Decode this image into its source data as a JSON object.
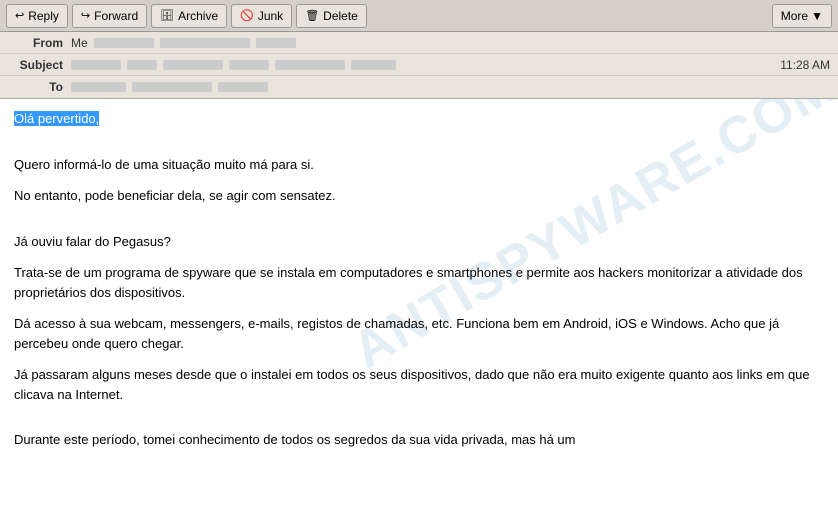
{
  "toolbar": {
    "reply_label": "Reply",
    "forward_label": "Forward",
    "archive_label": "Archive",
    "junk_label": "Junk",
    "delete_label": "Delete",
    "more_label": "More",
    "reply_icon": "↩",
    "forward_icon": "↪",
    "archive_icon": "🗄",
    "junk_icon": "🚫",
    "delete_icon": "🗑",
    "more_icon": "▼"
  },
  "email": {
    "from_label": "From",
    "from_me": "Me",
    "subject_label": "Subject",
    "to_label": "To",
    "time": "11:28 AM",
    "highlighted_greeting": "Olá pervertido,",
    "para1": "Quero informá-lo de uma situação muito má para si.",
    "para2": "No entanto, pode beneficiar dela, se agir com sensatez.",
    "para3": "Já ouviu falar do Pegasus?",
    "para4": "Trata-se de um programa de spyware que se instala em computadores e smartphones e permite aos hackers monitorizar a atividade dos proprietários dos dispositivos.",
    "para5": "Dá acesso à sua webcam, messengers, e-mails, registos de chamadas, etc. Funciona bem em Android, iOS e Windows. Acho que já percebeu onde quero chegar.",
    "para6": "Já passaram alguns meses desde que o instalei em todos os seus dispositivos, dado que não era muito exigente quanto aos links em que clicava na Internet.",
    "para7": "Durante este período, tomei conhecimento de todos os segredos da sua vida privada, mas há um"
  },
  "watermark": {
    "text": "ANTISPYWARE.COM"
  }
}
